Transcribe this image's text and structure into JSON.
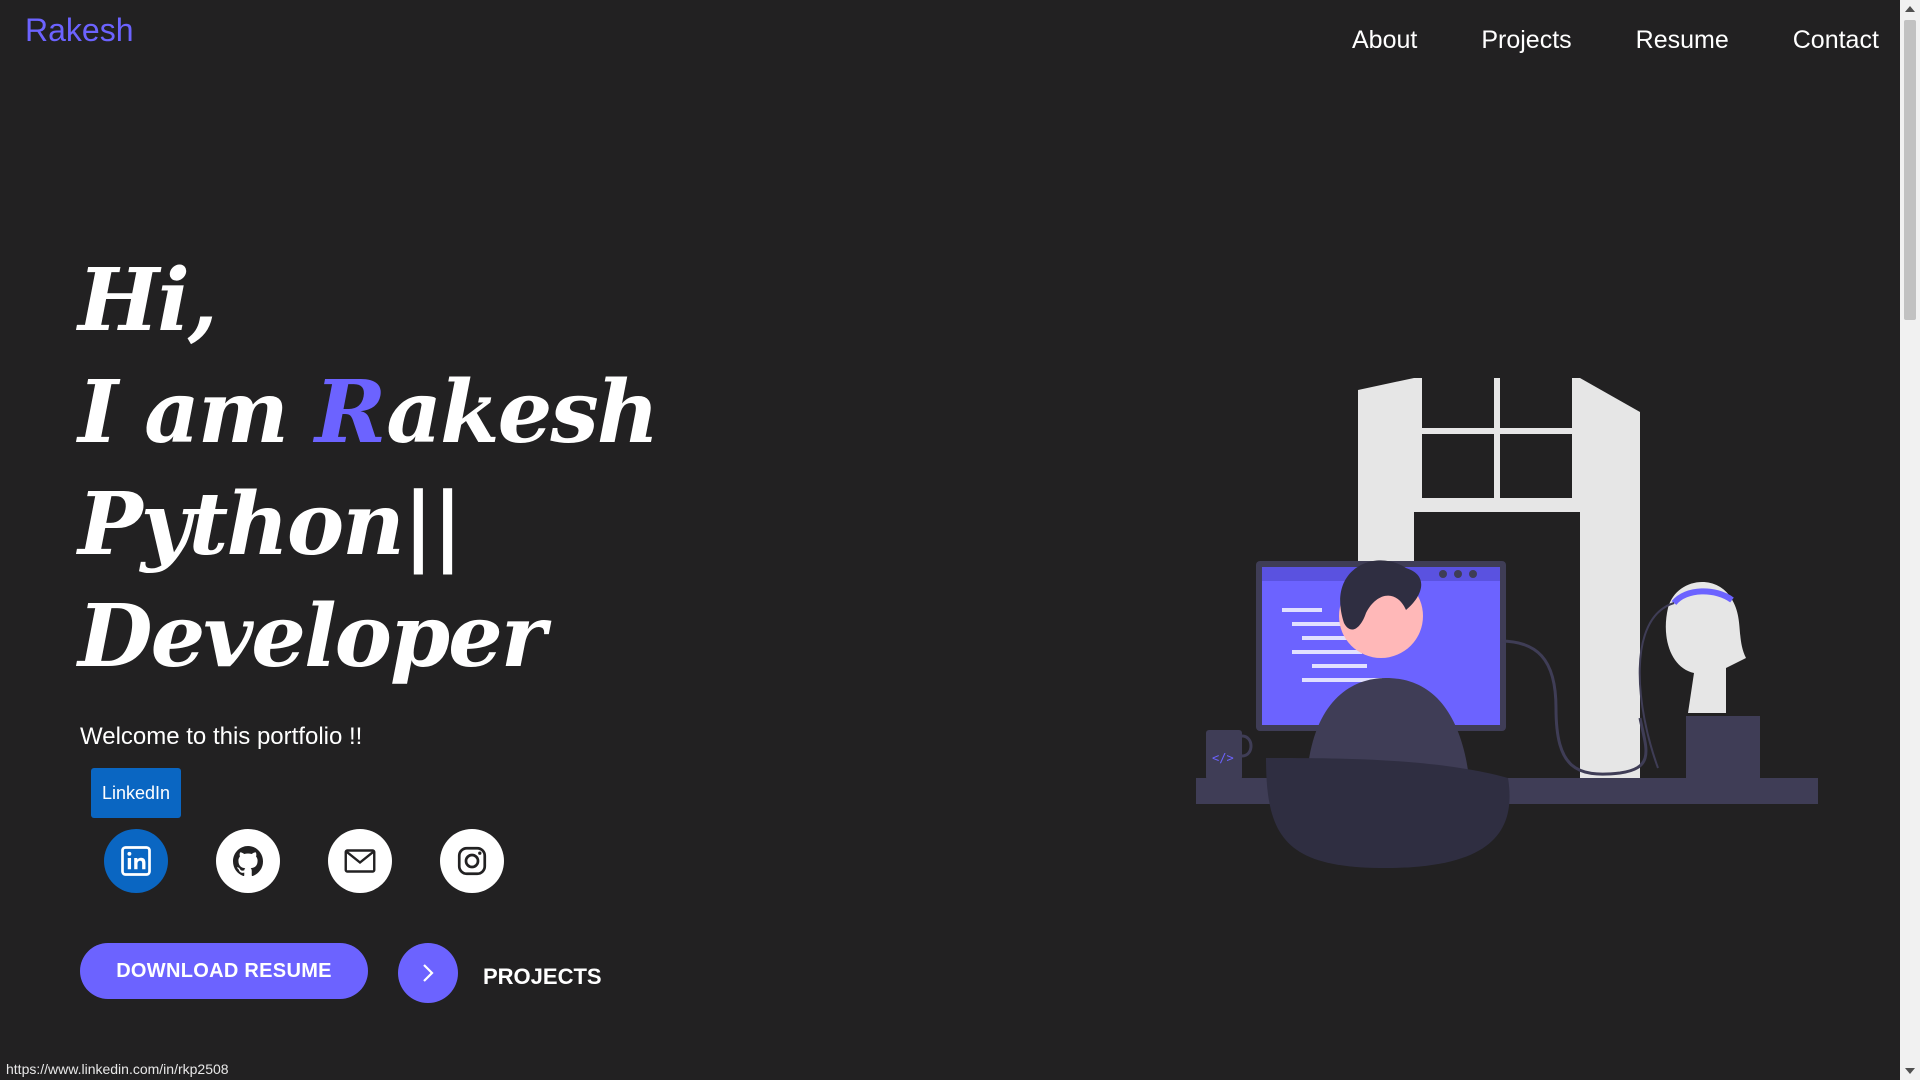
{
  "header": {
    "brand": "Rakesh",
    "nav": [
      "About",
      "Projects",
      "Resume",
      "Contact"
    ]
  },
  "hero": {
    "greeting": "Hi,",
    "intro_prefix": "I am ",
    "name_first_letter": "R",
    "name_rest": "akesh",
    "typing_text": "Python||",
    "role": "Developer",
    "welcome": "Welcome to this portfolio !!"
  },
  "tooltip": {
    "label": "LinkedIn"
  },
  "socials": [
    {
      "name": "linkedin-icon",
      "label": "LinkedIn"
    },
    {
      "name": "github-icon",
      "label": "GitHub"
    },
    {
      "name": "mail-icon",
      "label": "Email"
    },
    {
      "name": "instagram-icon",
      "label": "Instagram"
    }
  ],
  "actions": {
    "download_resume": "DOWNLOAD RESUME",
    "projects": "PROJECTS"
  },
  "status_url": "https://www.linkedin.com/in/rkp2508",
  "colors": {
    "background": "#222122",
    "accent": "#6c63ff",
    "linkedin": "#0a66c2"
  }
}
